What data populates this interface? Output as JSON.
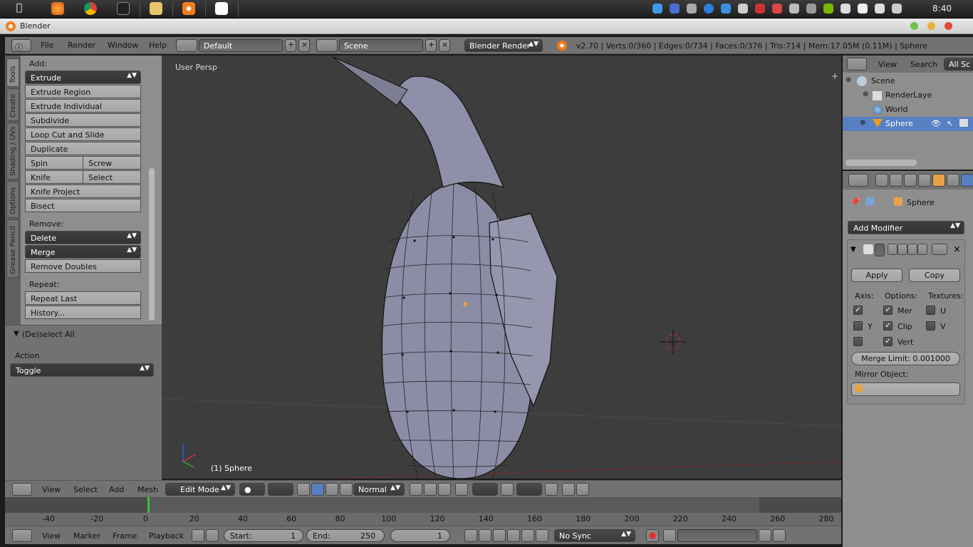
{
  "desktop": {
    "clock": "8:40"
  },
  "window": {
    "title": "Blender"
  },
  "info_header": {
    "menus": [
      "File",
      "Render",
      "Window",
      "Help"
    ],
    "layout": "Default",
    "scene": "Scene",
    "engine": "Blender Render",
    "stats": "v2.70 | Verts:0/360 | Edges:0/734 | Faces:0/376 | Tris:714 | Mem:17.05M (0.11M) | Sphere"
  },
  "tool_tabs": [
    "Tools",
    "Create",
    "Shading / UVs",
    "Options",
    "Grease Pencil"
  ],
  "tools": {
    "add_label": "Add:",
    "extrude": "Extrude",
    "extrude_region": "Extrude Region",
    "extrude_individual": "Extrude Individual",
    "subdivide": "Subdivide",
    "loop_cut": "Loop Cut and Slide",
    "duplicate": "Duplicate",
    "spin": "Spin",
    "screw": "Screw",
    "knife": "Knife",
    "select": "Select",
    "knife_project": "Knife Project",
    "bisect": "Bisect",
    "remove_label": "Remove:",
    "delete": "Delete",
    "merge": "Merge",
    "remove_doubles": "Remove Doubles",
    "repeat_label": "Repeat:",
    "repeat_last": "Repeat Last",
    "history": "History..."
  },
  "operator": {
    "title": "(De)select All",
    "action_label": "Action",
    "action_value": "Toggle"
  },
  "viewport": {
    "view_label": "User Persp",
    "object_label": "(1) Sphere"
  },
  "view3d_header": {
    "menus": [
      "View",
      "Select",
      "Add",
      "Mesh"
    ],
    "mode": "Edit Mode",
    "orientation": "Normal"
  },
  "timeline": {
    "ticks": [
      "-40",
      "-20",
      "0",
      "20",
      "40",
      "60",
      "80",
      "100",
      "120",
      "140",
      "160",
      "180",
      "200",
      "220",
      "240",
      "260",
      "280"
    ],
    "menus": [
      "View",
      "Marker",
      "Frame",
      "Playback"
    ],
    "start_label": "Start:",
    "start_value": "1",
    "end_label": "End:",
    "end_value": "250",
    "current_frame": "1",
    "sync": "No Sync"
  },
  "outliner": {
    "menus": [
      "View",
      "Search",
      "All Sc"
    ],
    "items": [
      "Scene",
      "RenderLaye",
      "World",
      "Sphere"
    ]
  },
  "properties": {
    "breadcrumb": "Sphere",
    "add_modifier": "Add Modifier",
    "apply": "Apply",
    "copy": "Copy",
    "axis_label": "Axis:",
    "options_label": "Options:",
    "textures_label": "Textures:",
    "axis_y": "Y",
    "opt_merge": "Mer",
    "opt_clip": "Clip",
    "opt_vert": "Vert",
    "tex_u": "U",
    "tex_v": "V",
    "merge_limit": "Merge Limit:  0.001000",
    "mirror_object_label": "Mirror Object:"
  },
  "colors": {
    "panel_bg": "#8e8e8e",
    "header_bg": "#727272",
    "viewport_bg": "#3d3d3d",
    "playhead": "#37c437",
    "selected_blue": "#5680c2"
  }
}
